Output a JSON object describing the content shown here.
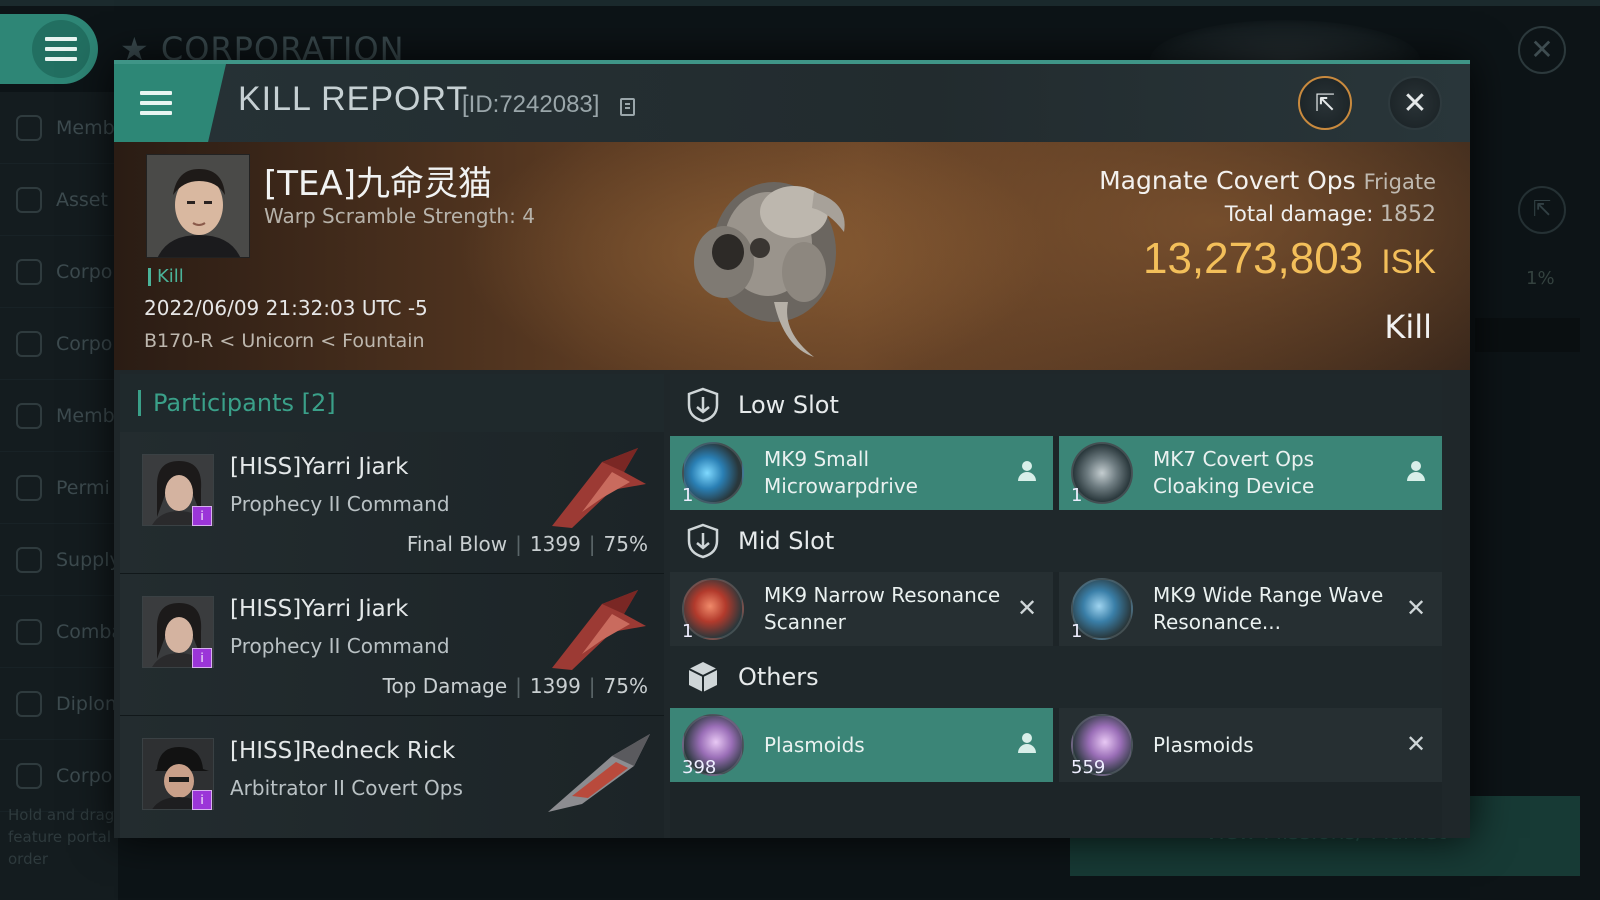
{
  "background": {
    "title": "CORPORATION",
    "sidebar": [
      {
        "label": "Memb"
      },
      {
        "label": "Asset"
      },
      {
        "label": "Corpo"
      },
      {
        "label": "Corpo"
      },
      {
        "label": "Memb Applic"
      },
      {
        "label": "Permi Manag"
      },
      {
        "label": "Supply"
      },
      {
        "label": "Comba"
      },
      {
        "label": "Diplom"
      },
      {
        "label": "Corpo"
      }
    ],
    "hint": "Hold and drag feature portal order",
    "percent": "1%",
    "bottom_button": "View Missions/ Market"
  },
  "modal": {
    "title": "KILL REPORT",
    "report_id": "[ID:7242083]"
  },
  "victim": {
    "name": "[TEA]九命灵猫",
    "warp_scramble": "Warp Scramble Strength: 4",
    "kill_tag": "Kill",
    "timestamp": "2022/06/09 21:32:03 UTC -5",
    "location": "B170-R < Unicorn < Fountain",
    "ship_name": "Magnate Covert Ops",
    "ship_class": "Frigate",
    "total_damage_label": "Total damage:",
    "total_damage": "1852",
    "isk_value": "13,273,803",
    "isk_unit": "ISK",
    "result": "Kill"
  },
  "participants": {
    "header": "Participants [2]",
    "rows": [
      {
        "name": "[HISS]Yarri Jiark",
        "ship": "Prophecy II Command",
        "role": "Final Blow",
        "damage": "1399",
        "percent": "75%"
      },
      {
        "name": "[HISS]Yarri Jiark",
        "ship": "Prophecy II Command",
        "role": "Top Damage",
        "damage": "1399",
        "percent": "75%"
      },
      {
        "name": "[HISS]Redneck Rick",
        "ship": "Arbitrator II Covert Ops",
        "role": "",
        "damage": "",
        "percent": ""
      }
    ]
  },
  "fitting": {
    "low_slot": {
      "label": "Low Slot",
      "items": [
        {
          "name": "MK9 Small Microwarpdrive",
          "qty": "1",
          "state": "fitted"
        },
        {
          "name": "MK7 Covert Ops Cloaking Device",
          "qty": "1",
          "state": "fitted"
        }
      ]
    },
    "mid_slot": {
      "label": "Mid Slot",
      "items": [
        {
          "name": "MK9 Narrow Resonance Scanner",
          "qty": "1",
          "state": "destroyed"
        },
        {
          "name": "MK9 Wide Range Wave Resonance...",
          "qty": "1",
          "state": "destroyed"
        }
      ]
    },
    "others": {
      "label": "Others",
      "items": [
        {
          "name": "Plasmoids",
          "qty": "398",
          "state": "fitted"
        },
        {
          "name": "Plasmoids",
          "qty": "559",
          "state": "destroyed"
        }
      ]
    }
  },
  "colors": {
    "accent": "#3aa089",
    "fitted_bg": "#3b8577",
    "isk": "#f3bf5a",
    "drone_badge": "#9b35d8"
  }
}
